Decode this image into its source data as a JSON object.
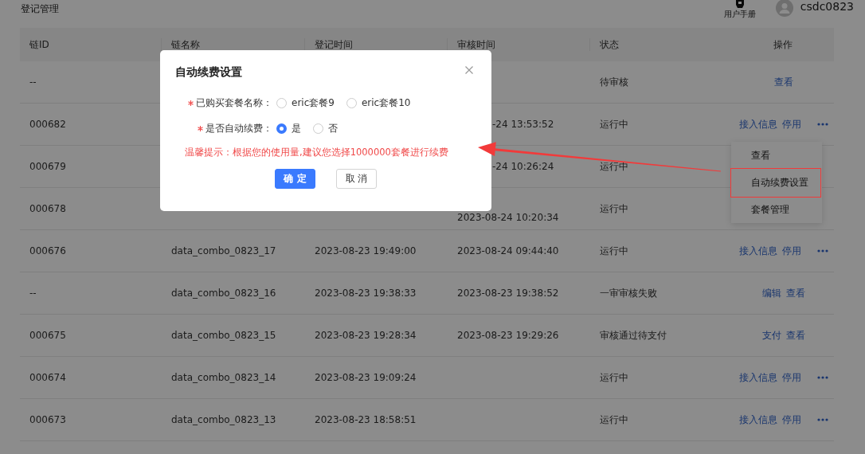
{
  "page_title": "登记管理",
  "header": {
    "help_label": "用户手册",
    "username": "csdc0823"
  },
  "table": {
    "columns": [
      "链ID",
      "链名称",
      "登记时间",
      "审核时间",
      "状态",
      "操作"
    ],
    "rows": [
      {
        "id": "--",
        "status": "待审核",
        "actions": [
          {
            "label": "查看"
          }
        ],
        "more": false
      },
      {
        "id": "000682",
        "reviewed": "-24 13:53:52",
        "covered_left": true,
        "status": "运行中",
        "actions": [
          {
            "label": "接入信息"
          },
          {
            "label": "停用"
          }
        ],
        "more": true
      },
      {
        "id": "000679",
        "reviewed": "-24 10:26:24",
        "covered_left": true,
        "status": "运行中",
        "more": false
      },
      {
        "id": "000678",
        "reviewed": "2023-08-24 10:20:34",
        "covered_top": true,
        "status": "运行中",
        "more": false
      },
      {
        "id": "000676",
        "name": "data_combo_0823_17",
        "registered": "2023-08-23 19:49:00",
        "reviewed": "2023-08-24 09:44:40",
        "status": "运行中",
        "actions": [
          {
            "label": "接入信息"
          },
          {
            "label": "停用"
          }
        ],
        "more": true
      },
      {
        "id": "--",
        "name": "data_combo_0823_16",
        "registered": "2023-08-23 19:38:33",
        "reviewed": "2023-08-23 19:38:52",
        "status": "一审审核失败",
        "actions": [
          {
            "label": "编辑"
          },
          {
            "label": "查看"
          }
        ],
        "more": false
      },
      {
        "id": "000675",
        "name": "data_combo_0823_15",
        "registered": "2023-08-23 19:28:34",
        "reviewed": "2023-08-23 19:29:26",
        "status": "审核通过待支付",
        "actions": [
          {
            "label": "支付"
          },
          {
            "label": "查看"
          }
        ],
        "more": false
      },
      {
        "id": "000674",
        "name": "data_combo_0823_14",
        "registered": "2023-08-23 19:09:24",
        "status": "运行中",
        "actions": [
          {
            "label": "接入信息"
          },
          {
            "label": "停用"
          }
        ],
        "more": true
      },
      {
        "id": "000673",
        "name": "data_combo_0823_13",
        "registered": "2023-08-23 18:58:51",
        "status": "运行中",
        "actions": [
          {
            "label": "接入信息"
          },
          {
            "label": "停用"
          }
        ],
        "more": true
      }
    ]
  },
  "dropdown": {
    "items": [
      {
        "label": "查看",
        "annotated": false
      },
      {
        "label": "自动续费设置",
        "annotated": true
      },
      {
        "label": "套餐管理",
        "annotated": false
      }
    ]
  },
  "dialog": {
    "title": "自动续费设置",
    "fields": [
      {
        "label": "已购买套餐名称：",
        "required": true,
        "options": [
          {
            "label": "eric套餐9",
            "selected": false
          },
          {
            "label": "eric套餐10",
            "selected": false
          }
        ]
      },
      {
        "label": "是否自动续费：",
        "required": true,
        "options": [
          {
            "label": "是",
            "selected": true
          },
          {
            "label": "否",
            "selected": false
          }
        ]
      }
    ],
    "hint": "温馨提示：根据您的使用量,建议您选择1000000套餐进行续费",
    "buttons": [
      {
        "label": "确 定",
        "kind": "primary"
      },
      {
        "label": "取 消",
        "kind": "default"
      }
    ]
  }
}
